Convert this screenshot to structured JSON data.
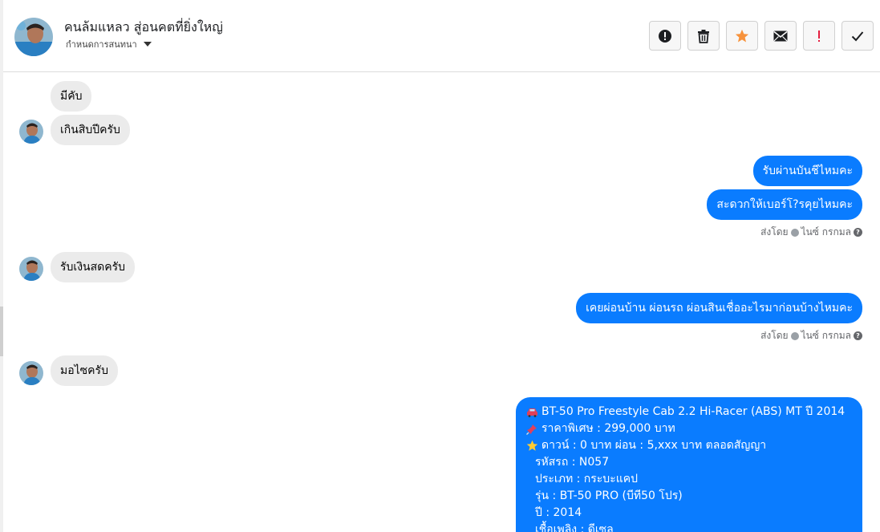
{
  "header": {
    "contact_name": "คนล้มแหลว สู่อนคตที่ยิ่งใหญ่",
    "assign_label": "กำหนดการสนทนา",
    "actions": [
      {
        "icon": "alert-circle-icon",
        "name": "mark-spam-button"
      },
      {
        "icon": "trash-icon",
        "name": "delete-button"
      },
      {
        "icon": "star-icon",
        "name": "star-button"
      },
      {
        "icon": "envelope-icon",
        "name": "mark-unread-button"
      },
      {
        "icon": "exclamation-icon",
        "name": "follow-up-button"
      },
      {
        "icon": "check-icon",
        "name": "done-button"
      }
    ],
    "colors": {
      "star": "#f7923b",
      "exclamation": "#e41e3f"
    }
  },
  "thread": {
    "messages": [
      {
        "side": "in",
        "text": "มีคับ"
      },
      {
        "side": "in",
        "text": "เกินสิบปีครับ"
      },
      {
        "side": "out",
        "text": "รับผ่านบันชีไหมคะ"
      },
      {
        "side": "out",
        "text": "สะดวกให้เบอร์โ?รคุยไหมคะ"
      },
      {
        "side": "in",
        "text": "รับเงินสดครับ"
      },
      {
        "side": "out",
        "text": "เคยผ่อนบ้าน ผ่อนรถ ผ่อนสินเชื่ออะไรมาก่อนบ้างไหมคะ"
      },
      {
        "side": "in",
        "text": "มอไซครับ"
      }
    ],
    "sent_by_label": "ส่งโดย",
    "sent_by_name": "ไนซ์ กรกมล",
    "card": {
      "lines": [
        {
          "emoji": "car-icon",
          "text": "BT-50 Pro Freestyle Cab 2.2 Hi-Racer (ABS) MT ปี 2014"
        },
        {
          "emoji": "pin-icon",
          "text": "ราคาพิเศษ : 299,000 บาท"
        },
        {
          "emoji": "star-icon",
          "text": "ดาวน์ : 0 บาท ผ่อน : 5,xxx บาท ตลอดสัญญา"
        },
        {
          "emoji": "",
          "text": "รหัสรถ : N057"
        },
        {
          "emoji": "",
          "text": "ประเภท : กระบะแคป"
        },
        {
          "emoji": "",
          "text": "รุ่น : BT-50 PRO (บีที50 โปร)"
        },
        {
          "emoji": "",
          "text": "ปี : 2014"
        },
        {
          "emoji": "",
          "text": "เชื้อเพลิง : ดีเซล"
        }
      ]
    },
    "colors": {
      "outgoing": "#0a7cff",
      "incoming": "#ebebeb"
    }
  }
}
